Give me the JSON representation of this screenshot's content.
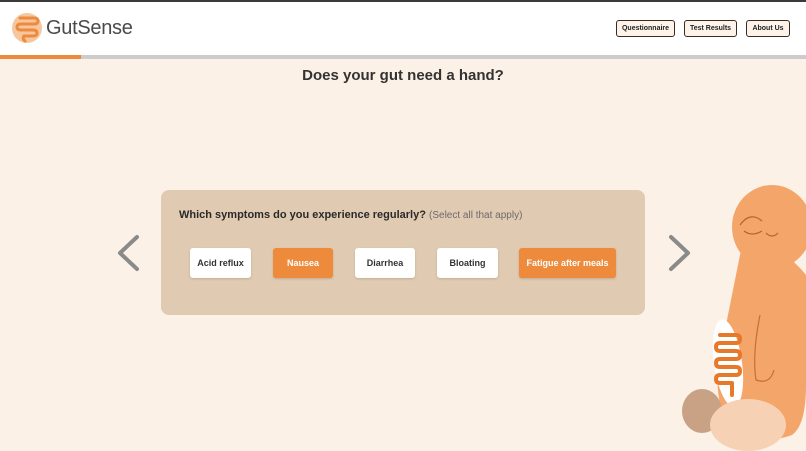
{
  "header": {
    "logo_text": "GutSense",
    "nav": [
      "Questionnaire",
      "Test Results",
      "About Us"
    ]
  },
  "progress": {
    "fraction": 0.1
  },
  "main": {
    "title": "Does your gut need a hand?",
    "question": "Which symptoms do you experience regularly?",
    "hint": "(Select all that apply)",
    "options": [
      {
        "label": "Acid reflux",
        "selected": false
      },
      {
        "label": "Nausea",
        "selected": true
      },
      {
        "label": "Diarrhea",
        "selected": false
      },
      {
        "label": "Bloating",
        "selected": false
      },
      {
        "label": "Fatigue after meals",
        "selected": true
      }
    ]
  },
  "colors": {
    "accent": "#ee8a3c",
    "background": "#fbf1e6",
    "card": "#e0cab1"
  },
  "icons": {
    "logo": "intestine-logo-icon",
    "prev": "chevron-left-icon",
    "next": "chevron-right-icon",
    "mascot": "gut-mascot-illustration"
  }
}
